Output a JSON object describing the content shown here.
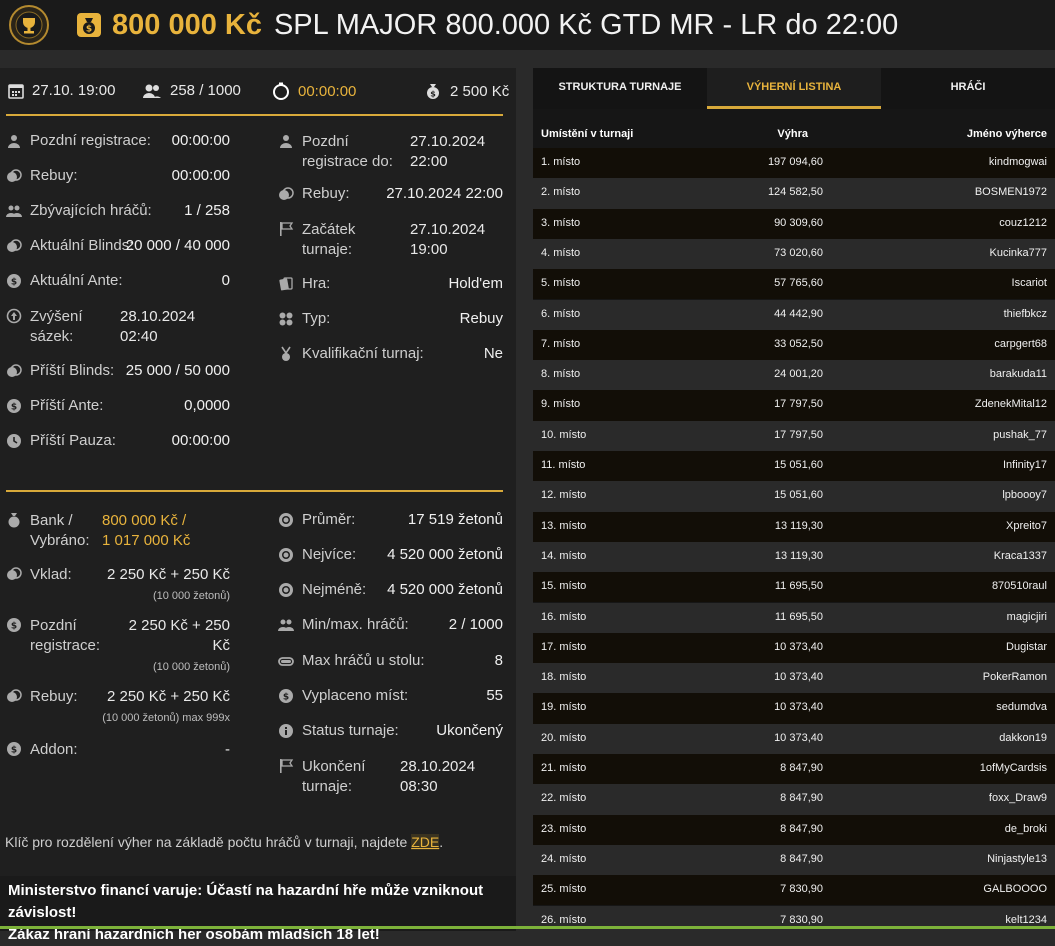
{
  "header": {
    "amount": "800 000 Kč",
    "title": "SPL MAJOR 800.000 Kč GTD MR - LR do 22:00"
  },
  "topstats": {
    "date": "27.10. 19:00",
    "players": "258 / 1000",
    "timer": "00:00:00",
    "buyin": "2 500 Kč"
  },
  "info_left": [
    {
      "label": "Pozdní registrace:",
      "value": "00:00:00",
      "icon": "person-icon"
    },
    {
      "label": "Rebuy:",
      "value": "00:00:00",
      "icon": "coins-icon"
    },
    {
      "label": "Zbývajících hráčů:",
      "value": "1 / 258",
      "icon": "people-icon"
    },
    {
      "label": "Aktuální Blinds:",
      "value": "20 000 / 40 000",
      "icon": "coins-icon"
    },
    {
      "label": "Aktuální Ante:",
      "value": "0",
      "icon": "dollar-icon"
    },
    {
      "label": "Zvýšení sázek:",
      "value": "28.10.2024 02:40",
      "icon": "up-icon"
    },
    {
      "label": "Příští Blinds:",
      "value": "25 000 / 50 000",
      "icon": "coins-icon"
    },
    {
      "label": "Příští Ante:",
      "value": "0,0000",
      "icon": "dollar-icon"
    },
    {
      "label": "Příští Pauza:",
      "value": "00:00:00",
      "icon": "clock-icon"
    }
  ],
  "info_right": [
    {
      "label": "Pozdní registrace do:",
      "value": "27.10.2024 22:00",
      "icon": "person-icon"
    },
    {
      "label": "Rebuy:",
      "value": "27.10.2024 22:00",
      "icon": "coins-icon"
    },
    {
      "label": "Začátek turnaje:",
      "value": "27.10.2024 19:00",
      "icon": "flag-icon"
    },
    {
      "label": "Hra:",
      "value": "Hold'em",
      "icon": "cards-icon"
    },
    {
      "label": "Typ:",
      "value": "Rebuy",
      "icon": "clubs-icon"
    },
    {
      "label": "Kvalifikační turnaj:",
      "value": "Ne",
      "icon": "medal-icon"
    }
  ],
  "bank": {
    "label": "Bank / Vybráno:",
    "value1": "800 000 Kč /",
    "value2": "1 017 000 Kč"
  },
  "fees": [
    {
      "label": "Vklad:",
      "value": "2 250 Kč + 250 Kč",
      "sub": "(10 000 žetonů)",
      "icon": "coins-icon"
    },
    {
      "label": "Pozdní registrace:",
      "value": "2 250 Kč + 250 Kč",
      "sub": "(10 000 žetonů)",
      "icon": "dollar-icon"
    },
    {
      "label": "Rebuy:",
      "value": "2 250 Kč + 250 Kč",
      "sub": "(10 000 žetonů) max 999x",
      "icon": "coins-icon"
    },
    {
      "label": "Addon:",
      "value": "-",
      "sub": "",
      "icon": "dollar-icon"
    }
  ],
  "stats_right": [
    {
      "label": "Průměr:",
      "value": "17 519 žetonů",
      "icon": "chip-icon"
    },
    {
      "label": "Nejvíce:",
      "value": "4 520 000 žetonů",
      "icon": "chip-icon"
    },
    {
      "label": "Nejméně:",
      "value": "4 520 000 žetonů",
      "icon": "chip-icon"
    },
    {
      "label": "Min/max. hráčů:",
      "value": "2 / 1000",
      "icon": "people-icon"
    },
    {
      "label": "Max hráčů u stolu:",
      "value": "8",
      "icon": "table-icon"
    },
    {
      "label": "Vyplaceno míst:",
      "value": "55",
      "icon": "dollar-icon"
    },
    {
      "label": "Status turnaje:",
      "value": "Ukončený",
      "icon": "info-icon"
    },
    {
      "label": "Ukončení turnaje:",
      "value": "28.10.2024 08:30",
      "icon": "flag-icon"
    }
  ],
  "note": {
    "text": "Klíč pro rozdělení výher na základě počtu hráčů v turnaji, najdete",
    "link": "ZDE",
    "after": "."
  },
  "warning": {
    "line1": "Ministerstvo financí varuje: Účastí na hazardní hře může vzniknout závislost!",
    "line2": "Zákaz hraní hazardních her osobám mladších 18 let!"
  },
  "tabs": [
    "STRUKTURA TURNAJE",
    "VÝHERNÍ LISTINA",
    "HRÁČI"
  ],
  "table": {
    "headers": [
      "Umístění v turnaji",
      "Výhra",
      "Jméno výherce"
    ],
    "rows": [
      [
        "1. místo",
        "197 094,60",
        "kindmogwai"
      ],
      [
        "2. místo",
        "124 582,50",
        "BOSMEN1972"
      ],
      [
        "3. místo",
        "90 309,60",
        "couz1212"
      ],
      [
        "4. místo",
        "73 020,60",
        "Kucinka777"
      ],
      [
        "5. místo",
        "57 765,60",
        "Iscariot"
      ],
      [
        "6. místo",
        "44 442,90",
        "thiefbkcz"
      ],
      [
        "7. místo",
        "33 052,50",
        "carpgert68"
      ],
      [
        "8. místo",
        "24 001,20",
        "barakuda11"
      ],
      [
        "9. místo",
        "17 797,50",
        "ZdenekMital12"
      ],
      [
        "10. místo",
        "17 797,50",
        "pushak_77"
      ],
      [
        "11. místo",
        "15 051,60",
        "Infinity17"
      ],
      [
        "12. místo",
        "15 051,60",
        "lpboooy7"
      ],
      [
        "13. místo",
        "13 119,30",
        "Xpreito7"
      ],
      [
        "14. místo",
        "13 119,30",
        "Kraca1337"
      ],
      [
        "15. místo",
        "11 695,50",
        "870510raul"
      ],
      [
        "16. místo",
        "11 695,50",
        "magicjiri"
      ],
      [
        "17. místo",
        "10 373,40",
        "Dugistar"
      ],
      [
        "18. místo",
        "10 373,40",
        "PokerRamon"
      ],
      [
        "19. místo",
        "10 373,40",
        "sedumdva"
      ],
      [
        "20. místo",
        "10 373,40",
        "dakkon19"
      ],
      [
        "21. místo",
        "8 847,90",
        "1ofMyCardsis"
      ],
      [
        "22. místo",
        "8 847,90",
        "foxx_Draw9"
      ],
      [
        "23. místo",
        "8 847,90",
        "de_broki"
      ],
      [
        "24. místo",
        "8 847,90",
        "Ninjastyle13"
      ],
      [
        "25. místo",
        "7 830,90",
        "GALBOOOO"
      ],
      [
        "26. místo",
        "7 830,90",
        "kelt1234"
      ]
    ]
  }
}
